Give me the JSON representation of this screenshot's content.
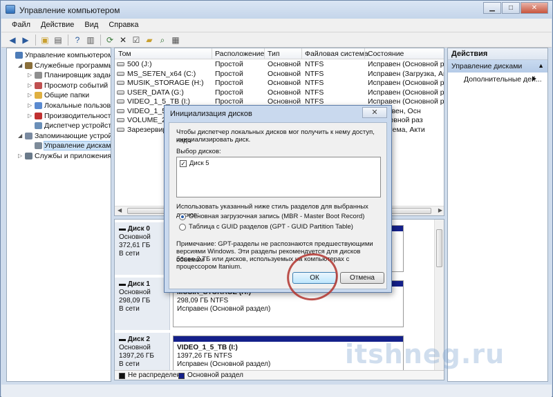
{
  "window": {
    "title": "Управление компьютером"
  },
  "menu": [
    "Файл",
    "Действие",
    "Вид",
    "Справка"
  ],
  "tree": [
    {
      "label": "Управление компьютером (л",
      "indent": 0,
      "expander": "",
      "icon": "computer-icon",
      "color": "#4d7cb8"
    },
    {
      "label": "Служебные программы",
      "indent": 1,
      "expander": "◢",
      "icon": "tools-icon",
      "color": "#8a6f3a"
    },
    {
      "label": "Планировщик заданий",
      "indent": 2,
      "expander": "▷",
      "icon": "clock-icon",
      "color": "#8f8f8f"
    },
    {
      "label": "Просмотр событий",
      "indent": 2,
      "expander": "▷",
      "icon": "event-viewer-icon",
      "color": "#c05050"
    },
    {
      "label": "Общие папки",
      "indent": 2,
      "expander": "▷",
      "icon": "shared-folder-icon",
      "color": "#e0b040"
    },
    {
      "label": "Локальные пользовате",
      "indent": 2,
      "expander": "▷",
      "icon": "users-icon",
      "color": "#5a8ad0"
    },
    {
      "label": "Производительность",
      "indent": 2,
      "expander": "▷",
      "icon": "performance-icon",
      "color": "#c03030"
    },
    {
      "label": "Диспетчер устройств",
      "indent": 2,
      "expander": "",
      "icon": "device-manager-icon",
      "color": "#6a8fb8"
    },
    {
      "label": "Запоминающие устройст",
      "indent": 1,
      "expander": "◢",
      "icon": "storage-icon",
      "color": "#7a8aa0"
    },
    {
      "label": "Управление дисками",
      "indent": 2,
      "expander": "",
      "icon": "disk-management-icon",
      "color": "#7d8b99",
      "selected": true
    },
    {
      "label": "Службы и приложения",
      "indent": 1,
      "expander": "▷",
      "icon": "services-icon",
      "color": "#6a7a8a"
    }
  ],
  "columns": [
    "Том",
    "Расположение",
    "Тип",
    "Файловая система",
    "Состояние"
  ],
  "volumes": [
    [
      "500 (J:)",
      "Простой",
      "Основной",
      "NTFS",
      "Исправен (Основной разд"
    ],
    [
      "MS_SE7EN_x64 (C:)",
      "Простой",
      "Основной",
      "NTFS",
      "Исправен (Загрузка, Ава"
    ],
    [
      "MUSIK_STORAGE (H:)",
      "Простой",
      "Основной",
      "NTFS",
      "Исправен (Основной разд"
    ],
    [
      "USER_DATA (G:)",
      "Простой",
      "Основной",
      "NTFS",
      "Исправен (Основной разд"
    ],
    [
      "VIDEO_1_5_TB (I:)",
      "Простой",
      "Основной",
      "NTFS",
      "Исправен (Основной разд"
    ],
    [
      "VIDEO_1_5_TB",
      "",
      "",
      "",
      "н (Активен, Осн"
    ],
    [
      "VOLUME_250",
      "",
      "",
      "",
      "н (Основной раз"
    ],
    [
      "Зарезервиро",
      "",
      "",
      "",
      "н (Система, Акти"
    ]
  ],
  "disks": [
    {
      "name": "Диск 0",
      "type": "Основной",
      "size": "372,61 ГБ",
      "status": "В сети",
      "part_name": "",
      "part_size": "",
      "part_status": ""
    },
    {
      "name": "Диск 1",
      "type": "Основной",
      "size": "298,09 ГБ",
      "status": "В сети",
      "part_name": "MUSIK_STORAGE (H:)",
      "part_size": "298,09 ГБ NTFS",
      "part_status": "Исправен (Основной раздел)"
    },
    {
      "name": "Диск 2",
      "type": "Основной",
      "size": "1397,26 ГБ",
      "status": "В сети",
      "part_name": "VIDEO_1_5_TB (I:)",
      "part_size": "1397,26 ГБ NTFS",
      "part_status": "Исправен (Основной раздел)"
    }
  ],
  "legend": {
    "unallocated": "Не распределен",
    "primary": "Основной раздел",
    "unallocated_color": "#111111",
    "primary_color": "#14208a"
  },
  "actions": {
    "header": "Действия",
    "section": "Управление дисками",
    "more": "Дополнительные дей..."
  },
  "dialog": {
    "title": "Инициализация дисков",
    "intro_line1": "Чтобы диспетчер локальных дисков мог получить к нему доступ, надо",
    "intro_line2": "инициализировать диск.",
    "select_label": "Выбор дисков:",
    "disk_item": "Диск 5",
    "style_label": "Использовать указанный ниже стиль разделов для выбранных дисков:",
    "mbr_option": "Основная загрузочная запись (MBR - Master Boot Record)",
    "gpt_option": "Таблица с GUID разделов (GPT - GUID Partition Table)",
    "note_line1": "Примечание: GPT-разделы не распознаются предшествующими",
    "note_line2": "версиями Windows. Эти разделы рекомендуется для дисков объемом",
    "note_line3": "более 2 ТБ или дисков, используемых на компьютерах с",
    "note_line4": "процессором Itanium.",
    "ok_label": "ОК",
    "cancel_label": "Отмена"
  },
  "watermark": "itshneg.ru"
}
